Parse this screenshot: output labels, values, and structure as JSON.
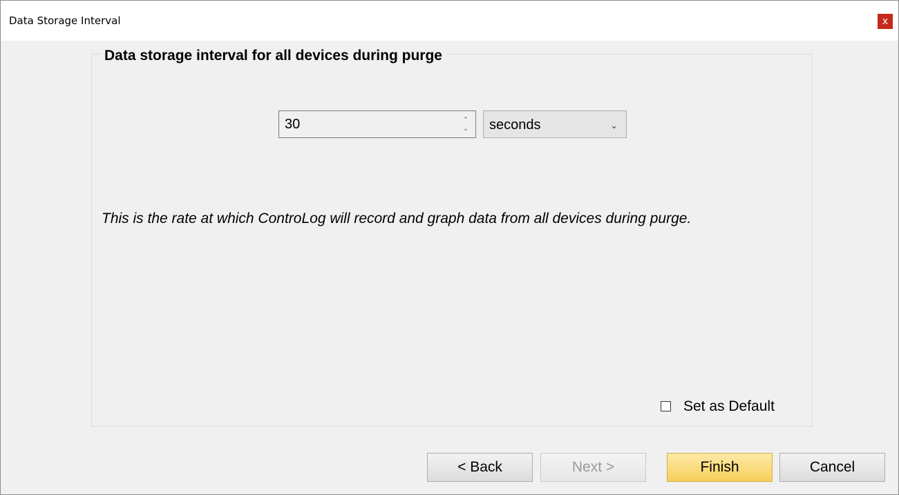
{
  "window": {
    "title": "Data Storage Interval",
    "close_label": "x"
  },
  "group": {
    "title": "Data storage interval for all devices during purge"
  },
  "interval": {
    "value": "30",
    "spin_up": "⌃",
    "spin_down": "⌄",
    "unit": "seconds",
    "unit_arrow": "⌄"
  },
  "description": "This is the rate at which ControLog will record and graph data from all devices during purge.",
  "default_checkbox": {
    "label": "Set as Default",
    "checked": false
  },
  "buttons": {
    "back": "< Back",
    "next": "Next >",
    "finish": "Finish",
    "cancel": "Cancel"
  }
}
